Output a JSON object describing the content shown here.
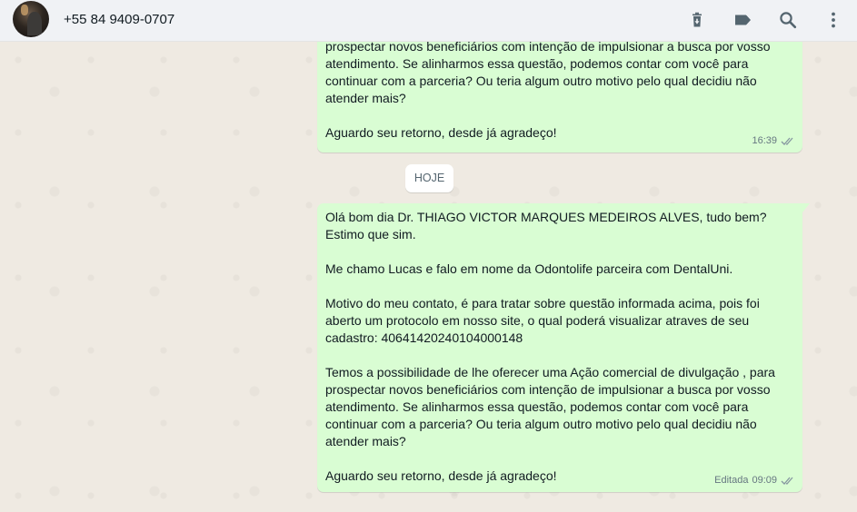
{
  "header": {
    "contact_name": "+55 84 9409-0707",
    "icons": [
      "delete-icon",
      "label-icon",
      "search-icon",
      "menu-icon"
    ]
  },
  "chat": {
    "date_divider": "HOJE",
    "messages": [
      {
        "paragraphs": [
          "prospectar novos beneficiários com intenção de impulsionar a busca por vosso atendimento. Se alinharmos essa questão, podemos contar com você para continuar com a parceria? Ou teria algum outro motivo pelo qual decidiu não atender mais?",
          "Aguardo seu retorno, desde já agradeço!"
        ],
        "time": "16:39",
        "status": "read"
      },
      {
        "paragraphs": [
          "Olá bom dia Dr. THIAGO VICTOR MARQUES MEDEIROS ALVES, tudo bem? Estimo que sim.",
          "Me chamo Lucas e falo em nome da Odontolife parceira com DentalUni.",
          "Motivo do meu contato, é para tratar sobre questão informada acima, pois foi aberto um protocolo em nosso site, o qual poderá visualizar atraves de seu cadastro: 40641420240104000148",
          "Temos a possibilidade de lhe oferecer uma Ação comercial de divulgação , para prospectar novos beneficiários com intenção de impulsionar a busca por vosso atendimento. Se alinharmos essa questão, podemos contar com você para continuar com a parceria? Ou teria algum outro motivo pelo qual decidiu não atender mais?",
          "Aguardo seu retorno, desde já agradeço!"
        ],
        "edited_label": "Editada",
        "time": "09:09",
        "status": "read"
      }
    ]
  },
  "colors": {
    "header_bg": "#f0f2f5",
    "chat_bg": "#efeae2",
    "outgoing_bubble": "#d9fdd3",
    "icon": "#54656f",
    "read_check": "#8696a0"
  }
}
